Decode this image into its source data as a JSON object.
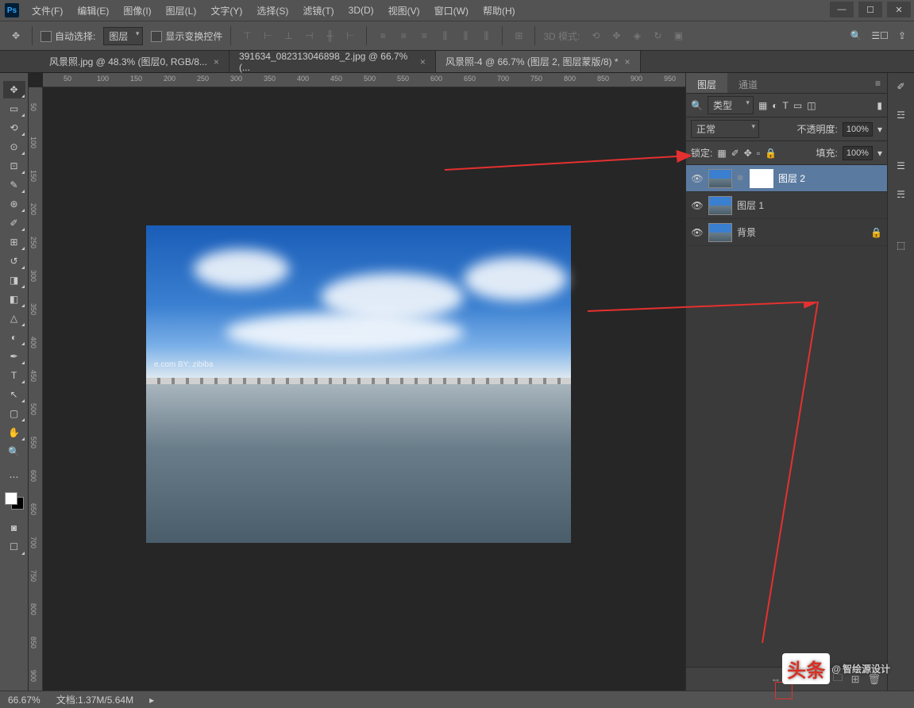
{
  "menubar": {
    "items": [
      "文件(F)",
      "编辑(E)",
      "图像(I)",
      "图层(L)",
      "文字(Y)",
      "选择(S)",
      "滤镜(T)",
      "3D(D)",
      "视图(V)",
      "窗口(W)",
      "帮助(H)"
    ]
  },
  "optionsbar": {
    "auto_select_label": "自动选择:",
    "layer_dropdown": "图层",
    "show_transform_label": "显示变换控件",
    "mode_3d_label": "3D 模式:"
  },
  "doc_tabs": [
    {
      "title": "风景照.jpg @ 48.3% (图层0, RGB/8...",
      "active": false
    },
    {
      "title": "391634_082313046898_2.jpg @ 66.7% (...",
      "active": false
    },
    {
      "title": "风景照-4 @ 66.7% (图层 2, 图层蒙版/8) *",
      "active": true
    }
  ],
  "ruler_h": [
    "50",
    "100",
    "150",
    "200",
    "250",
    "300",
    "350",
    "400",
    "450",
    "500",
    "550",
    "600",
    "650",
    "700",
    "750",
    "800",
    "850",
    "900",
    "950"
  ],
  "ruler_v": [
    "50",
    "100",
    "150",
    "200",
    "250",
    "300",
    "350",
    "400",
    "450",
    "500",
    "550",
    "600",
    "650",
    "700",
    "750",
    "800",
    "850",
    "900"
  ],
  "canvas_watermark": "e.com   BY: zibiba",
  "panels": {
    "tabs": {
      "layers": "图层",
      "channels": "通道"
    },
    "filter_label": "类型",
    "blend_mode": "正常",
    "opacity_label": "不透明度:",
    "opacity_value": "100%",
    "lock_label": "锁定:",
    "fill_label": "填充:",
    "fill_value": "100%",
    "layers": [
      {
        "name": "图层 2",
        "mask": true,
        "selected": true,
        "locked": false
      },
      {
        "name": "图层 1",
        "mask": false,
        "selected": false,
        "locked": false
      },
      {
        "name": "背景",
        "mask": false,
        "selected": false,
        "locked": true
      }
    ]
  },
  "statusbar": {
    "zoom": "66.67%",
    "doc_label": "文档:",
    "doc_size": "1.37M/5.64M"
  },
  "watermark_overlay": {
    "badge": "头条",
    "at": "@",
    "name": "智绘源设计"
  }
}
